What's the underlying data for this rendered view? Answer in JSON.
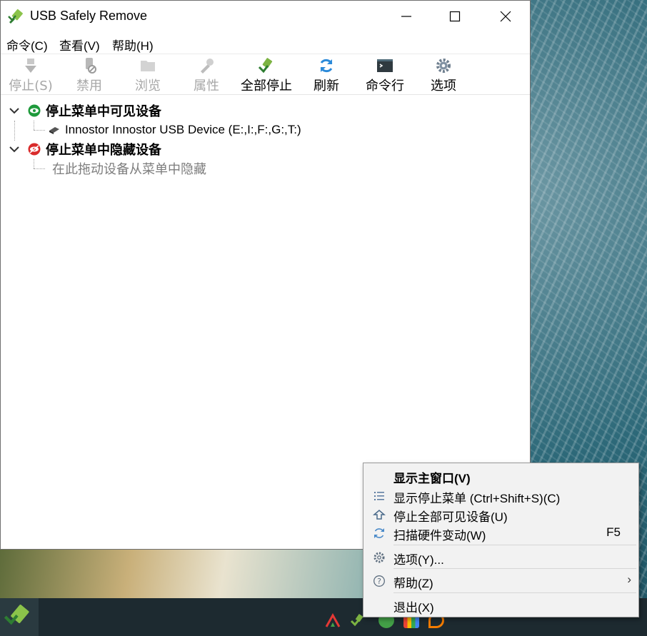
{
  "window": {
    "title": "USB Safely Remove",
    "controls": {
      "minimize": "minimize",
      "maximize": "maximize",
      "close": "close"
    }
  },
  "menubar": [
    {
      "label": "命令(C)"
    },
    {
      "label": "查看(V)"
    },
    {
      "label": "帮助(H)"
    }
  ],
  "toolbar": {
    "stop": {
      "label": "停止(S)",
      "enabled": false,
      "icon": "stop-icon"
    },
    "disable": {
      "label": "禁用",
      "enabled": false,
      "icon": "usb-disable-icon"
    },
    "browse": {
      "label": "浏览",
      "enabled": false,
      "icon": "folder-icon"
    },
    "properties": {
      "label": "属性",
      "enabled": false,
      "icon": "properties-icon"
    },
    "stop_all": {
      "label": "全部停止",
      "enabled": true,
      "icon": "stop-all-icon"
    },
    "refresh": {
      "label": "刷新",
      "enabled": true,
      "icon": "refresh-icon"
    },
    "command_line": {
      "label": "命令行",
      "enabled": true,
      "icon": "terminal-icon"
    },
    "options": {
      "label": "选项",
      "enabled": true,
      "icon": "gear-icon"
    }
  },
  "tree": {
    "visible_group": {
      "label": "停止菜单中可见设备",
      "icon": "eye-icon",
      "devices": [
        {
          "label": "Innostor Innostor USB Device (E:,I:,F:,G:,T:)"
        }
      ]
    },
    "hidden_group": {
      "label": "停止菜单中隐藏设备",
      "icon": "eye-hidden-icon",
      "hint": "在此拖动设备从菜单中隐藏"
    }
  },
  "context_menu": {
    "show_main": {
      "label": "显示主窗口(V)"
    },
    "show_stop_menu": {
      "label": "显示停止菜单 (Ctrl+Shift+S)(C)"
    },
    "stop_all_visible": {
      "label": "停止全部可见设备(U)"
    },
    "scan_hardware": {
      "label": "扫描硬件变动(W)",
      "accelerator": "F5"
    },
    "options": {
      "label": "选项(Y)..."
    },
    "help": {
      "label": "帮助(Z)",
      "submenu_arrow": "›"
    },
    "exit": {
      "label": "退出(X)"
    }
  },
  "colors": {
    "visible_group": "#1e9a3b",
    "hidden_group": "#d92b2b",
    "refresh": "#2b8ad9",
    "disabled_text": "#a7a7a7",
    "hint_text": "#7d7d7d"
  }
}
